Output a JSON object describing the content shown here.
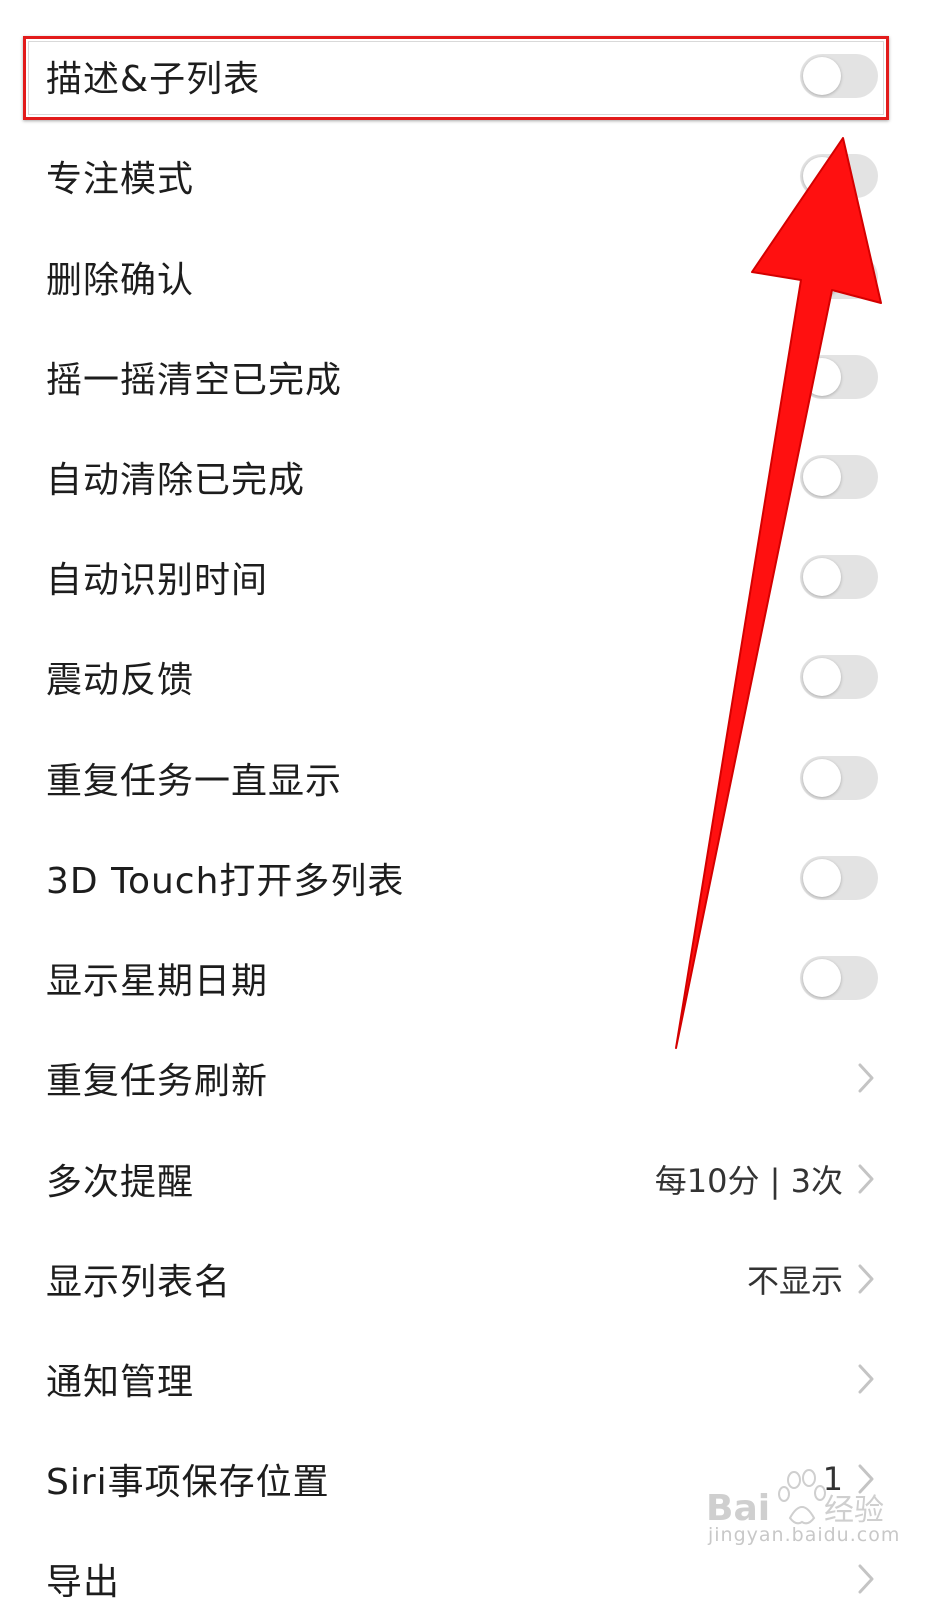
{
  "settings": {
    "rows": [
      {
        "label": "描述&子列表",
        "type": "toggle",
        "on": false
      },
      {
        "label": "专注模式",
        "type": "toggle",
        "on": false
      },
      {
        "label": "删除确认",
        "type": "toggle",
        "on": false
      },
      {
        "label": "摇一摇清空已完成",
        "type": "toggle",
        "on": false
      },
      {
        "label": "自动清除已完成",
        "type": "toggle",
        "on": false
      },
      {
        "label": "自动识别时间",
        "type": "toggle",
        "on": false
      },
      {
        "label": "震动反馈",
        "type": "toggle",
        "on": false
      },
      {
        "label": "重复任务一直显示",
        "type": "toggle",
        "on": false
      },
      {
        "label": "3D Touch打开多列表",
        "type": "toggle",
        "on": false
      },
      {
        "label": "显示星期日期",
        "type": "toggle",
        "on": false
      },
      {
        "label": "重复任务刷新",
        "type": "link",
        "value": ""
      },
      {
        "label": "多次提醒",
        "type": "link",
        "value": "每10分 | 3次"
      },
      {
        "label": "显示列表名",
        "type": "link",
        "value": "不显示"
      },
      {
        "label": "通知管理",
        "type": "link",
        "value": ""
      },
      {
        "label": "Siri事项保存位置",
        "type": "link",
        "value": "1"
      },
      {
        "label": "导出",
        "type": "link",
        "value": ""
      }
    ]
  },
  "watermark": {
    "brand": "Baidu经验",
    "url": "jingyan.baidu.com"
  },
  "colors": {
    "annotation": "#ff1010",
    "toggle_off": "#e3e3e3",
    "text": "#1d1d1d",
    "chevron": "#c4c4c4"
  }
}
